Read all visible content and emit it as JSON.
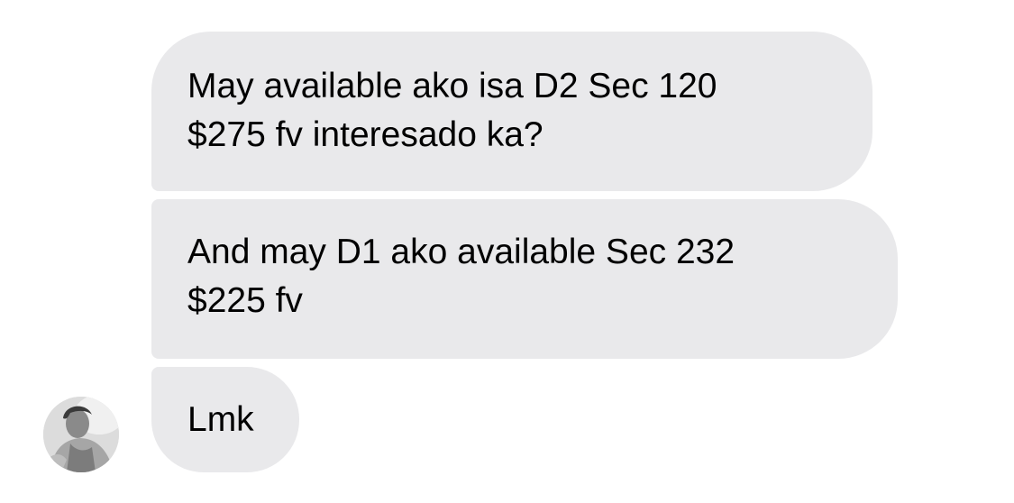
{
  "conversation": {
    "messages": [
      {
        "sender": "other",
        "text": "May available ako isa D2 Sec 120\n$275 fv interesado ka?"
      },
      {
        "sender": "other",
        "text": "And may D1 ako available Sec 232\n$225 fv"
      },
      {
        "sender": "other",
        "text": "Lmk"
      }
    ],
    "bubble_color": "#e9e9eb",
    "avatar": {
      "icon": "contact-photo",
      "style": "grayscale"
    }
  }
}
